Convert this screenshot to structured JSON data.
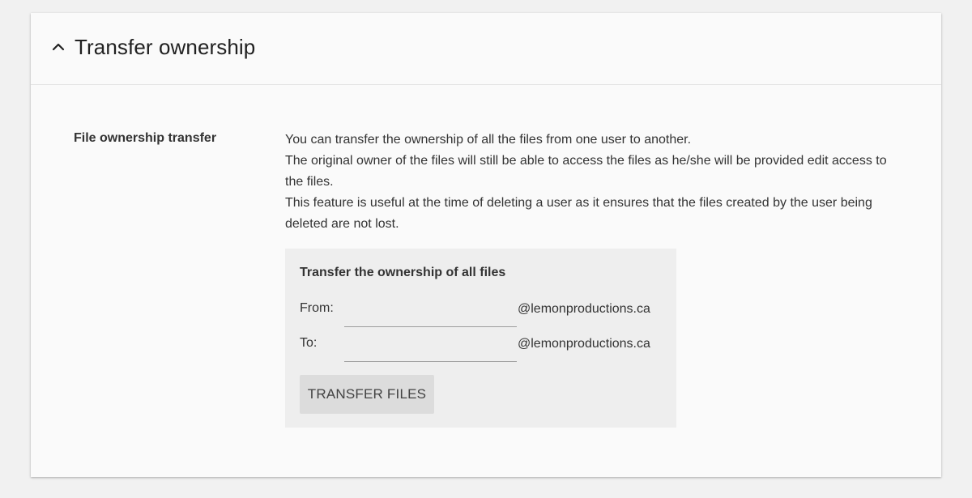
{
  "section": {
    "title": "Transfer ownership",
    "collapse_icon": "chevron-up-icon"
  },
  "setting": {
    "label": "File ownership transfer",
    "description": [
      "You can transfer the ownership of all the files from one user to another.",
      "The original owner of the files will still be able to access the files as he/she will be provided edit access to the files.",
      "This feature is useful at the time of deleting a user as it ensures that the files created by the user being deleted are not lost."
    ]
  },
  "panel": {
    "title": "Transfer the ownership of all files",
    "from": {
      "label": "From:",
      "value": "",
      "placeholder": "",
      "domain": "@lemonproductions.ca"
    },
    "to": {
      "label": "To:",
      "value": "",
      "placeholder": "",
      "domain": "@lemonproductions.ca"
    },
    "button_label": "TRANSFER FILES"
  },
  "colors": {
    "page_background": "#f1f1f1",
    "card_background": "#fafafa",
    "panel_background": "#eeeeee",
    "button_background": "#dcdcdc"
  }
}
